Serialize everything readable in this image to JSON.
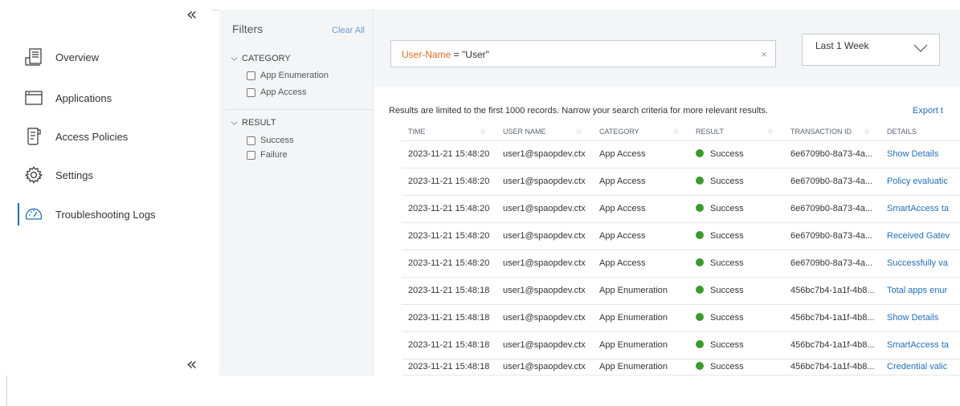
{
  "sidebar": {
    "collapse_glyph": "«",
    "items": [
      {
        "label": "Overview",
        "icon": "overview-icon",
        "active": false
      },
      {
        "label": "Applications",
        "icon": "applications-icon",
        "active": false
      },
      {
        "label": "Access Policies",
        "icon": "access-policies-icon",
        "active": false
      },
      {
        "label": "Settings",
        "icon": "gear-icon",
        "active": true
      },
      {
        "label": "Troubleshooting Logs",
        "icon": "gauge-icon",
        "active": true
      }
    ]
  },
  "filters": {
    "title": "Filters",
    "clear_label": "Clear All",
    "groups": [
      {
        "label": "CATEGORY",
        "options": [
          "App Enumeration",
          "App Access"
        ]
      },
      {
        "label": "RESULT",
        "options": [
          "Success",
          "Failure"
        ]
      }
    ]
  },
  "search": {
    "query_key": "User-Name",
    "query_rest": " = \"User\"",
    "clear_glyph": "×",
    "time_range": "Last 1 Week"
  },
  "results": {
    "info": "Results are limited to the first 1000 records. Narrow your search criteria for more relevant results.",
    "export_label": "Export t",
    "columns": [
      "TIME",
      "USER NAME",
      "CATEGORY",
      "RESULT",
      "TRANSACTION ID",
      "DETAILS"
    ],
    "rows": [
      {
        "time": "2023-11-21 15:48:20",
        "user": "user1@spaopdev.ctx",
        "category": "App Access",
        "result": "Success",
        "txn": "6e6709b0-8a73-4a...",
        "details": "Show Details"
      },
      {
        "time": "2023-11-21 15:48:20",
        "user": "user1@spaopdev.ctx",
        "category": "App Access",
        "result": "Success",
        "txn": "6e6709b0-8a73-4a...",
        "details": "Policy evaluatic"
      },
      {
        "time": "2023-11-21 15:48:20",
        "user": "user1@spaopdev.ctx",
        "category": "App Access",
        "result": "Success",
        "txn": "6e6709b0-8a73-4a...",
        "details": "SmartAccess ta"
      },
      {
        "time": "2023-11-21 15:48:20",
        "user": "user1@spaopdev.ctx",
        "category": "App Access",
        "result": "Success",
        "txn": "6e6709b0-8a73-4a...",
        "details": "Received Gatev"
      },
      {
        "time": "2023-11-21 15:48:20",
        "user": "user1@spaopdev.ctx",
        "category": "App Access",
        "result": "Success",
        "txn": "6e6709b0-8a73-4a...",
        "details": "Successfully va"
      },
      {
        "time": "2023-11-21 15:48:18",
        "user": "user1@spaopdev.ctx",
        "category": "App Enumeration",
        "result": "Success",
        "txn": "456bc7b4-1a1f-4b8...",
        "details": "Total apps enur"
      },
      {
        "time": "2023-11-21 15:48:18",
        "user": "user1@spaopdev.ctx",
        "category": "App Enumeration",
        "result": "Success",
        "txn": "456bc7b4-1a1f-4b8...",
        "details": "Show Details"
      },
      {
        "time": "2023-11-21 15:48:18",
        "user": "user1@spaopdev.ctx",
        "category": "App Enumeration",
        "result": "Success",
        "txn": "456bc7b4-1a1f-4b8...",
        "details": "SmartAccess ta"
      },
      {
        "time": "2023-11-21 15:48:18",
        "user": "user1@spaopdev.ctx",
        "category": "App Enumeration",
        "result": "Success",
        "txn": "456bc7b4-1a1f-4b8...",
        "details": "Credential valic"
      }
    ],
    "success_color": "#3a9a2c",
    "link_color": "#1f6fb5",
    "query_key_color": "#e66b1e"
  }
}
